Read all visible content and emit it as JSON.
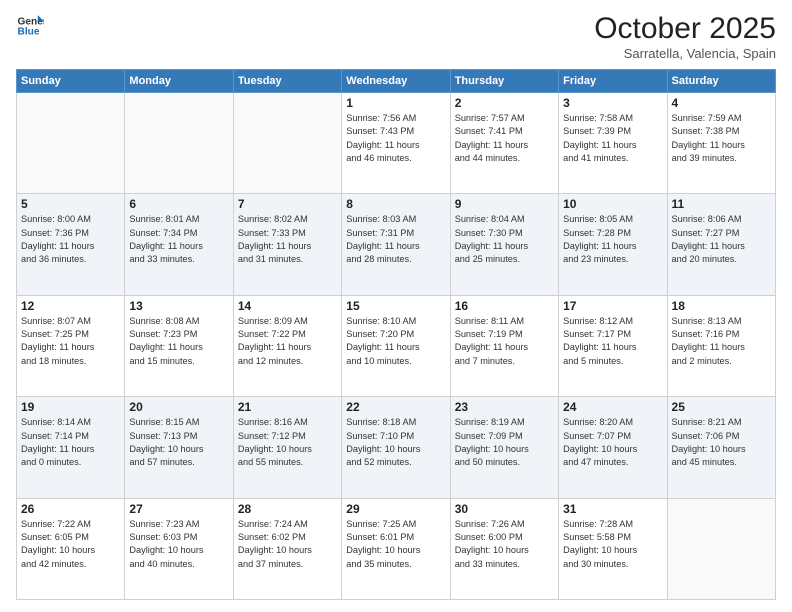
{
  "header": {
    "logo_line1": "General",
    "logo_line2": "Blue",
    "month": "October 2025",
    "location": "Sarratella, Valencia, Spain"
  },
  "days_of_week": [
    "Sunday",
    "Monday",
    "Tuesday",
    "Wednesday",
    "Thursday",
    "Friday",
    "Saturday"
  ],
  "weeks": [
    [
      {
        "day": "",
        "info": ""
      },
      {
        "day": "",
        "info": ""
      },
      {
        "day": "",
        "info": ""
      },
      {
        "day": "1",
        "info": "Sunrise: 7:56 AM\nSunset: 7:43 PM\nDaylight: 11 hours\nand 46 minutes."
      },
      {
        "day": "2",
        "info": "Sunrise: 7:57 AM\nSunset: 7:41 PM\nDaylight: 11 hours\nand 44 minutes."
      },
      {
        "day": "3",
        "info": "Sunrise: 7:58 AM\nSunset: 7:39 PM\nDaylight: 11 hours\nand 41 minutes."
      },
      {
        "day": "4",
        "info": "Sunrise: 7:59 AM\nSunset: 7:38 PM\nDaylight: 11 hours\nand 39 minutes."
      }
    ],
    [
      {
        "day": "5",
        "info": "Sunrise: 8:00 AM\nSunset: 7:36 PM\nDaylight: 11 hours\nand 36 minutes."
      },
      {
        "day": "6",
        "info": "Sunrise: 8:01 AM\nSunset: 7:34 PM\nDaylight: 11 hours\nand 33 minutes."
      },
      {
        "day": "7",
        "info": "Sunrise: 8:02 AM\nSunset: 7:33 PM\nDaylight: 11 hours\nand 31 minutes."
      },
      {
        "day": "8",
        "info": "Sunrise: 8:03 AM\nSunset: 7:31 PM\nDaylight: 11 hours\nand 28 minutes."
      },
      {
        "day": "9",
        "info": "Sunrise: 8:04 AM\nSunset: 7:30 PM\nDaylight: 11 hours\nand 25 minutes."
      },
      {
        "day": "10",
        "info": "Sunrise: 8:05 AM\nSunset: 7:28 PM\nDaylight: 11 hours\nand 23 minutes."
      },
      {
        "day": "11",
        "info": "Sunrise: 8:06 AM\nSunset: 7:27 PM\nDaylight: 11 hours\nand 20 minutes."
      }
    ],
    [
      {
        "day": "12",
        "info": "Sunrise: 8:07 AM\nSunset: 7:25 PM\nDaylight: 11 hours\nand 18 minutes."
      },
      {
        "day": "13",
        "info": "Sunrise: 8:08 AM\nSunset: 7:23 PM\nDaylight: 11 hours\nand 15 minutes."
      },
      {
        "day": "14",
        "info": "Sunrise: 8:09 AM\nSunset: 7:22 PM\nDaylight: 11 hours\nand 12 minutes."
      },
      {
        "day": "15",
        "info": "Sunrise: 8:10 AM\nSunset: 7:20 PM\nDaylight: 11 hours\nand 10 minutes."
      },
      {
        "day": "16",
        "info": "Sunrise: 8:11 AM\nSunset: 7:19 PM\nDaylight: 11 hours\nand 7 minutes."
      },
      {
        "day": "17",
        "info": "Sunrise: 8:12 AM\nSunset: 7:17 PM\nDaylight: 11 hours\nand 5 minutes."
      },
      {
        "day": "18",
        "info": "Sunrise: 8:13 AM\nSunset: 7:16 PM\nDaylight: 11 hours\nand 2 minutes."
      }
    ],
    [
      {
        "day": "19",
        "info": "Sunrise: 8:14 AM\nSunset: 7:14 PM\nDaylight: 11 hours\nand 0 minutes."
      },
      {
        "day": "20",
        "info": "Sunrise: 8:15 AM\nSunset: 7:13 PM\nDaylight: 10 hours\nand 57 minutes."
      },
      {
        "day": "21",
        "info": "Sunrise: 8:16 AM\nSunset: 7:12 PM\nDaylight: 10 hours\nand 55 minutes."
      },
      {
        "day": "22",
        "info": "Sunrise: 8:18 AM\nSunset: 7:10 PM\nDaylight: 10 hours\nand 52 minutes."
      },
      {
        "day": "23",
        "info": "Sunrise: 8:19 AM\nSunset: 7:09 PM\nDaylight: 10 hours\nand 50 minutes."
      },
      {
        "day": "24",
        "info": "Sunrise: 8:20 AM\nSunset: 7:07 PM\nDaylight: 10 hours\nand 47 minutes."
      },
      {
        "day": "25",
        "info": "Sunrise: 8:21 AM\nSunset: 7:06 PM\nDaylight: 10 hours\nand 45 minutes."
      }
    ],
    [
      {
        "day": "26",
        "info": "Sunrise: 7:22 AM\nSunset: 6:05 PM\nDaylight: 10 hours\nand 42 minutes."
      },
      {
        "day": "27",
        "info": "Sunrise: 7:23 AM\nSunset: 6:03 PM\nDaylight: 10 hours\nand 40 minutes."
      },
      {
        "day": "28",
        "info": "Sunrise: 7:24 AM\nSunset: 6:02 PM\nDaylight: 10 hours\nand 37 minutes."
      },
      {
        "day": "29",
        "info": "Sunrise: 7:25 AM\nSunset: 6:01 PM\nDaylight: 10 hours\nand 35 minutes."
      },
      {
        "day": "30",
        "info": "Sunrise: 7:26 AM\nSunset: 6:00 PM\nDaylight: 10 hours\nand 33 minutes."
      },
      {
        "day": "31",
        "info": "Sunrise: 7:28 AM\nSunset: 5:58 PM\nDaylight: 10 hours\nand 30 minutes."
      },
      {
        "day": "",
        "info": ""
      }
    ]
  ]
}
